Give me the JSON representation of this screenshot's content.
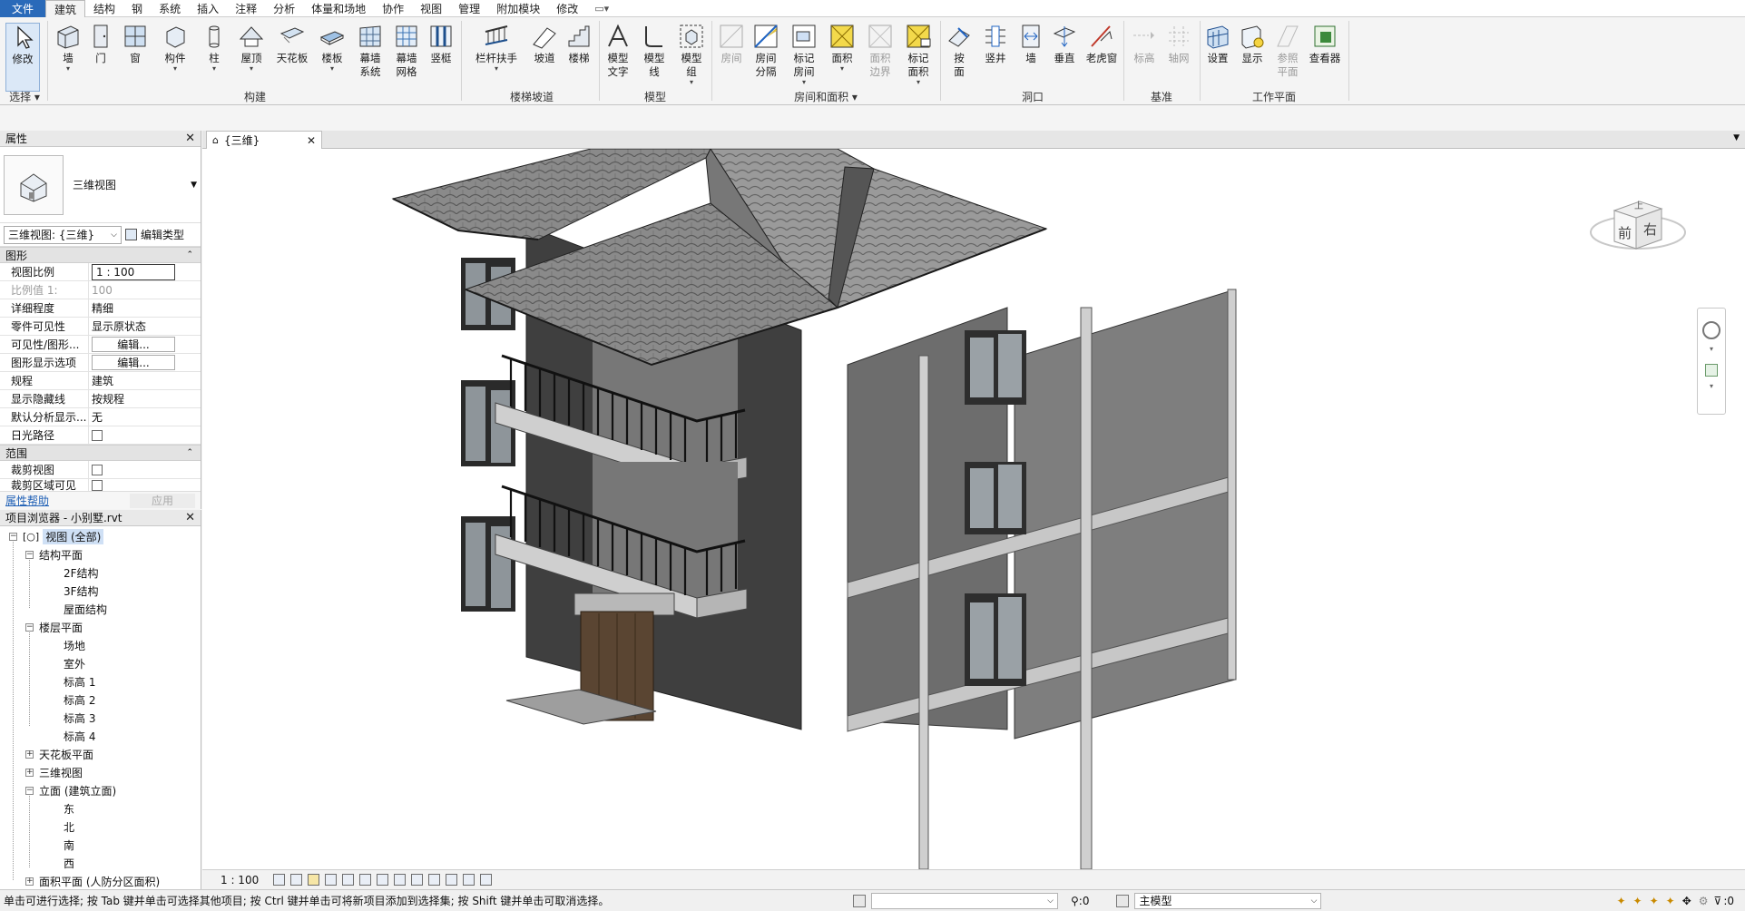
{
  "menu_tabs": [
    "文件",
    "建筑",
    "结构",
    "钢",
    "系统",
    "插入",
    "注释",
    "分析",
    "体量和场地",
    "协作",
    "视图",
    "管理",
    "附加模块",
    "修改"
  ],
  "quick_access": "▭▾",
  "ribbon": {
    "select": {
      "modify": "修改",
      "select_group": "选择"
    },
    "build": [
      "墙",
      "门",
      "窗",
      "构件",
      "柱",
      "屋顶",
      "天花板",
      "楼板",
      "幕墙\n系统",
      "幕墙\n网格",
      "竖梃"
    ],
    "stair": [
      "栏杆扶手",
      "坡道",
      "楼梯"
    ],
    "model": [
      "模型\n文字",
      "模型\n线",
      "模型\n组"
    ],
    "room": [
      "房间",
      "房间\n分隔",
      "标记\n房间",
      "面积",
      "面积\n边界",
      "标记\n面积"
    ],
    "opening": [
      "按\n面",
      "竖井",
      "墙",
      "垂直",
      "老虎窗"
    ],
    "datum": [
      "标高",
      "轴网"
    ],
    "workplane": [
      "设置",
      "显示",
      "参照\n平面",
      "查看器"
    ],
    "groups": {
      "select": "选择 ▾",
      "build": "构建",
      "stair": "楼梯坡道",
      "model": "模型",
      "room": "房间和面积 ▾",
      "opening": "洞口",
      "datum": "基准",
      "workplane": "工作平面"
    }
  },
  "properties": {
    "title": "属性",
    "type_name": "三维视图",
    "view_selector": "三维视图: {三维}",
    "edit_type": "编辑类型",
    "section_graphics": "图形",
    "rows": [
      {
        "k": "视图比例",
        "v": "1 : 100"
      },
      {
        "k": "比例值 1:",
        "v": "100"
      },
      {
        "k": "详细程度",
        "v": "精细"
      },
      {
        "k": "零件可见性",
        "v": "显示原状态"
      },
      {
        "k": "可见性/图形...",
        "v": "编辑..."
      },
      {
        "k": "图形显示选项",
        "v": "编辑..."
      },
      {
        "k": "规程",
        "v": "建筑"
      },
      {
        "k": "显示隐藏线",
        "v": "按规程"
      },
      {
        "k": "默认分析显示...",
        "v": "无"
      },
      {
        "k": "日光路径",
        "v": ""
      }
    ],
    "section_extents": "范围",
    "rows2": [
      {
        "k": "裁剪视图",
        "v": ""
      },
      {
        "k": "裁剪区域可见",
        "v": ""
      }
    ],
    "help": "属性帮助",
    "apply": "应用"
  },
  "browser": {
    "title": "项目浏览器 - 小别墅.rvt",
    "nodes": [
      "视图 (全部)",
      "结构平面",
      "2F结构",
      "3F结构",
      "屋面结构",
      "楼层平面",
      "场地",
      "室外",
      "标高 1",
      "标高 2",
      "标高 3",
      "标高 4",
      "天花板平面",
      "三维视图",
      "立面 (建筑立面)",
      "东",
      "北",
      "南",
      "西",
      "面积平面 (人防分区面积)"
    ]
  },
  "view_tab": "{三维}",
  "viewcube": {
    "front": "前",
    "right": "右",
    "top": "上"
  },
  "scale_label": "1 : 100",
  "status": {
    "message": "单击可进行选择; 按 Tab 键并单击可选择其他项目; 按 Ctrl 键并单击可将新项目添加到选择集; 按 Shift 键并单击可取消选择。",
    "sel_count": ":0",
    "model": "主模型",
    "filter_count": ":0"
  }
}
